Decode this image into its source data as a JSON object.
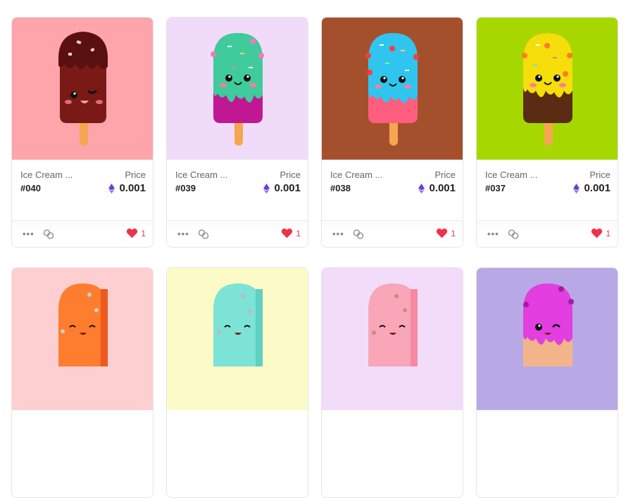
{
  "cards": [
    {
      "name": "Ice Cream ...",
      "price_label": "Price",
      "token": "#040",
      "price": "0.001",
      "likes": "1",
      "bg": "#fda5ab"
    },
    {
      "name": "Ice Cream ...",
      "price_label": "Price",
      "token": "#039",
      "price": "0.001",
      "likes": "1",
      "bg": "#f0dcf9"
    },
    {
      "name": "Ice Cream ...",
      "price_label": "Price",
      "token": "#038",
      "price": "0.001",
      "likes": "1",
      "bg": "#a5502c"
    },
    {
      "name": "Ice Cream ...",
      "price_label": "Price",
      "token": "#037",
      "price": "0.001",
      "likes": "1",
      "bg": "#a6d800"
    },
    {
      "bg": "#fecfd1"
    },
    {
      "bg": "#fcfbc8"
    },
    {
      "bg": "#f2dcfa"
    },
    {
      "bg": "#b8a9e6"
    }
  ],
  "colors": {
    "like": "#ee3347",
    "eth": "#6a3fd0"
  }
}
